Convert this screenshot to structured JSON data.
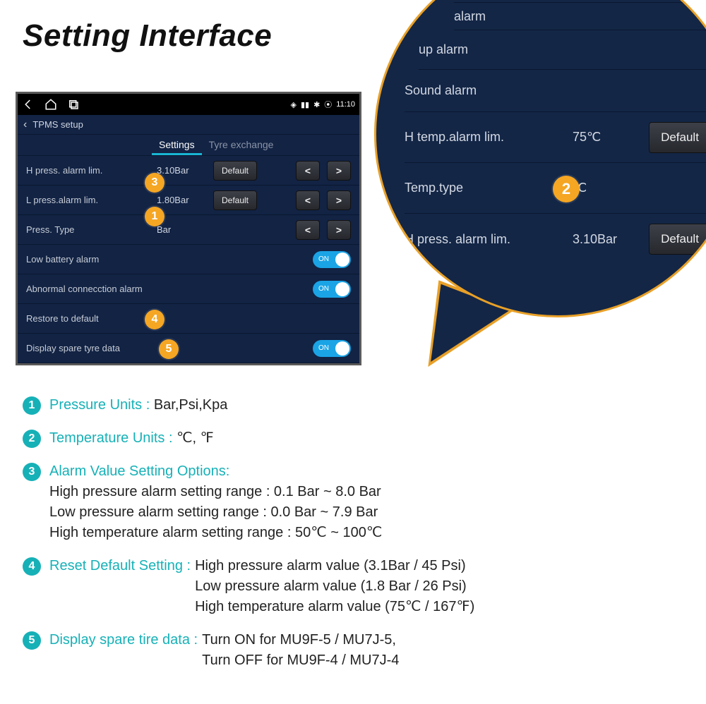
{
  "title": "Setting Interface",
  "device": {
    "status": {
      "clock": "11:10"
    },
    "subheader": "TPMS setup",
    "tabs": {
      "settings": "Settings",
      "tyre_exchange": "Tyre exchange"
    },
    "rows": {
      "hpress": {
        "label": "H press. alarm lim.",
        "value": "3.10Bar",
        "default": "Default"
      },
      "lpress": {
        "label": "L press.alarm lim.",
        "value": "1.80Bar",
        "default": "Default"
      },
      "ptype": {
        "label": "Press. Type",
        "value": "Bar"
      },
      "lowbatt": {
        "label": "Low battery alarm",
        "toggle": "ON"
      },
      "abnormal": {
        "label": "Abnormal connecction alarm",
        "toggle": "ON"
      },
      "restore": {
        "label": "Restore to default"
      },
      "spare": {
        "label": "Display spare tyre data",
        "toggle": "ON"
      }
    }
  },
  "bubble": {
    "frag1": "alarm",
    "frag2": "up alarm",
    "sound": "Sound alarm",
    "htemp": {
      "label": "H temp.alarm lim.",
      "value": "75℃",
      "default": "Default"
    },
    "ttype": {
      "label": "Temp.type",
      "value": "℃"
    },
    "hpress": {
      "label": "H press. alarm lim.",
      "value": "3.10Bar",
      "default": "Default"
    }
  },
  "legend": {
    "i1": {
      "head": "Pressure Units :",
      "body": "Bar,Psi,Kpa"
    },
    "i2": {
      "head": "Temperature Units :",
      "body": "℃, ℉"
    },
    "i3": {
      "head": "Alarm Value Setting Options:",
      "l1": "High pressure alarm setting range : 0.1 Bar ~ 8.0 Bar",
      "l2": "Low pressure alarm setting range  : 0.0 Bar ~  7.9 Bar",
      "l3": "High temperature alarm setting range : 50℃ ~ 100℃"
    },
    "i4": {
      "head": "Reset Default Setting :",
      "l1": "High pressure alarm value   (3.1Bar / 45 Psi)",
      "l2": "Low pressure alarm value (1.8 Bar / 26 Psi)",
      "l3": "High temperature alarm value  (75℃ / 167℉)"
    },
    "i5": {
      "head": "Display spare tire data :",
      "l1": "Turn ON for MU9F-5 / MU7J-5,",
      "l2": "Turn OFF for MU9F-4 / MU7J-4"
    }
  }
}
